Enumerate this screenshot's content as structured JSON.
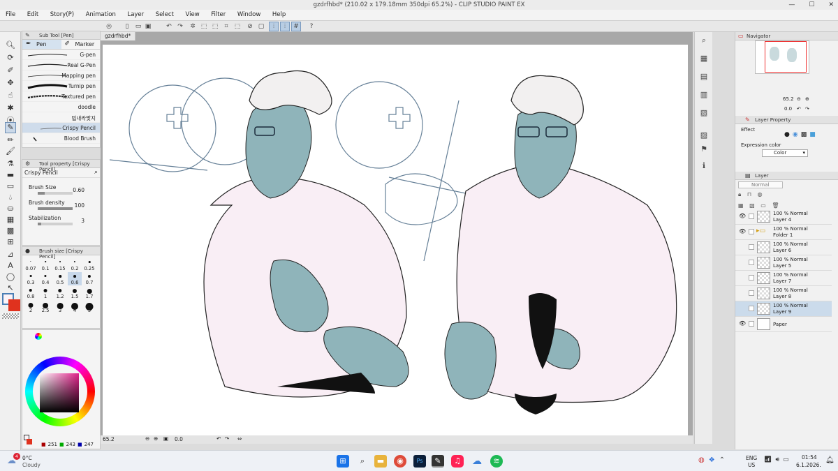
{
  "app": {
    "title": "gzdrfhbd* (210.02 x 179.18mm 350dpi 65.2%)  - CLIP STUDIO PAINT EX",
    "window_controls": [
      "—",
      "☐",
      "✕"
    ]
  },
  "menu": [
    "File",
    "Edit",
    "Story(P)",
    "Animation",
    "Layer",
    "Select",
    "View",
    "Filter",
    "Window",
    "Help"
  ],
  "sub_tool": {
    "header": "Sub Tool [Pen]",
    "tabs": [
      "Pen",
      "Marker"
    ],
    "brushes": [
      "G-pen",
      "Real G-Pen",
      "Mapping pen",
      "Turnip pen",
      "Textured pen",
      "doodle",
      "빕내라맞지",
      "Crispy Pencil",
      "Blood Brush"
    ],
    "selected": "Crispy Pencil"
  },
  "tool_property": {
    "header": "Tool property [Crispy Pencil]",
    "name": "Crispy Pencil",
    "rows": [
      {
        "label": "Brush Size",
        "value": "0.60",
        "fill": 0.2
      },
      {
        "label": "Brush density",
        "value": "100",
        "fill": 1.0
      },
      {
        "label": "Stabilization",
        "value": "3",
        "fill": 0.1
      }
    ]
  },
  "brush_size": {
    "header": "Brush size [Crispy Pencil]",
    "sizes": [
      "0.07",
      "0.1",
      "0.15",
      "0.2",
      "0.25",
      "0.3",
      "0.4",
      "0.5",
      "0.6",
      "0.7",
      "0.8",
      "1",
      "1.2",
      "1.5",
      "1.7",
      "2",
      "2.5",
      "3",
      "4",
      "5"
    ],
    "selected": "0.6"
  },
  "color": {
    "r": "251",
    "g": "243",
    "b": "247",
    "main": "#fbf3f7",
    "sub": "#e0321e"
  },
  "canvas": {
    "doc_tab": "gzdrfhbd*",
    "zoom": "65.2",
    "rotation": "0.0"
  },
  "navigator": {
    "header": "Navigator",
    "zoom": "65.2",
    "rotation": "0.0"
  },
  "layer_property": {
    "header": "Layer Property",
    "effect_label": "Effect",
    "expression_label": "Expression color",
    "expression_value": "Color"
  },
  "layers": {
    "header": "Layer",
    "blend_mode": "Normal",
    "items": [
      {
        "mode": "100 % Normal",
        "name": "Layer 4",
        "visible": true,
        "folder": false,
        "active": false
      },
      {
        "mode": "100 % Normal",
        "name": "Folder 1",
        "visible": true,
        "folder": true,
        "active": false
      },
      {
        "mode": "100 % Normal",
        "name": "Layer 6",
        "visible": false,
        "folder": false,
        "active": false
      },
      {
        "mode": "100 % Normal",
        "name": "Layer 5",
        "visible": false,
        "folder": false,
        "active": false
      },
      {
        "mode": "100 % Normal",
        "name": "Layer 7",
        "visible": false,
        "folder": false,
        "active": false
      },
      {
        "mode": "100 % Normal",
        "name": "Layer 8",
        "visible": false,
        "folder": false,
        "active": false
      },
      {
        "mode": "100 % Normal",
        "name": "Layer 9",
        "visible": false,
        "folder": false,
        "active": true
      },
      {
        "mode": "",
        "name": "Paper",
        "visible": true,
        "folder": false,
        "active": false
      }
    ]
  },
  "taskbar": {
    "weather_temp": "0°C",
    "weather_desc": "Cloudy",
    "weather_badge": "4",
    "lang": "ENG",
    "region": "US",
    "time": "01:54",
    "date": "6.1.2026."
  }
}
